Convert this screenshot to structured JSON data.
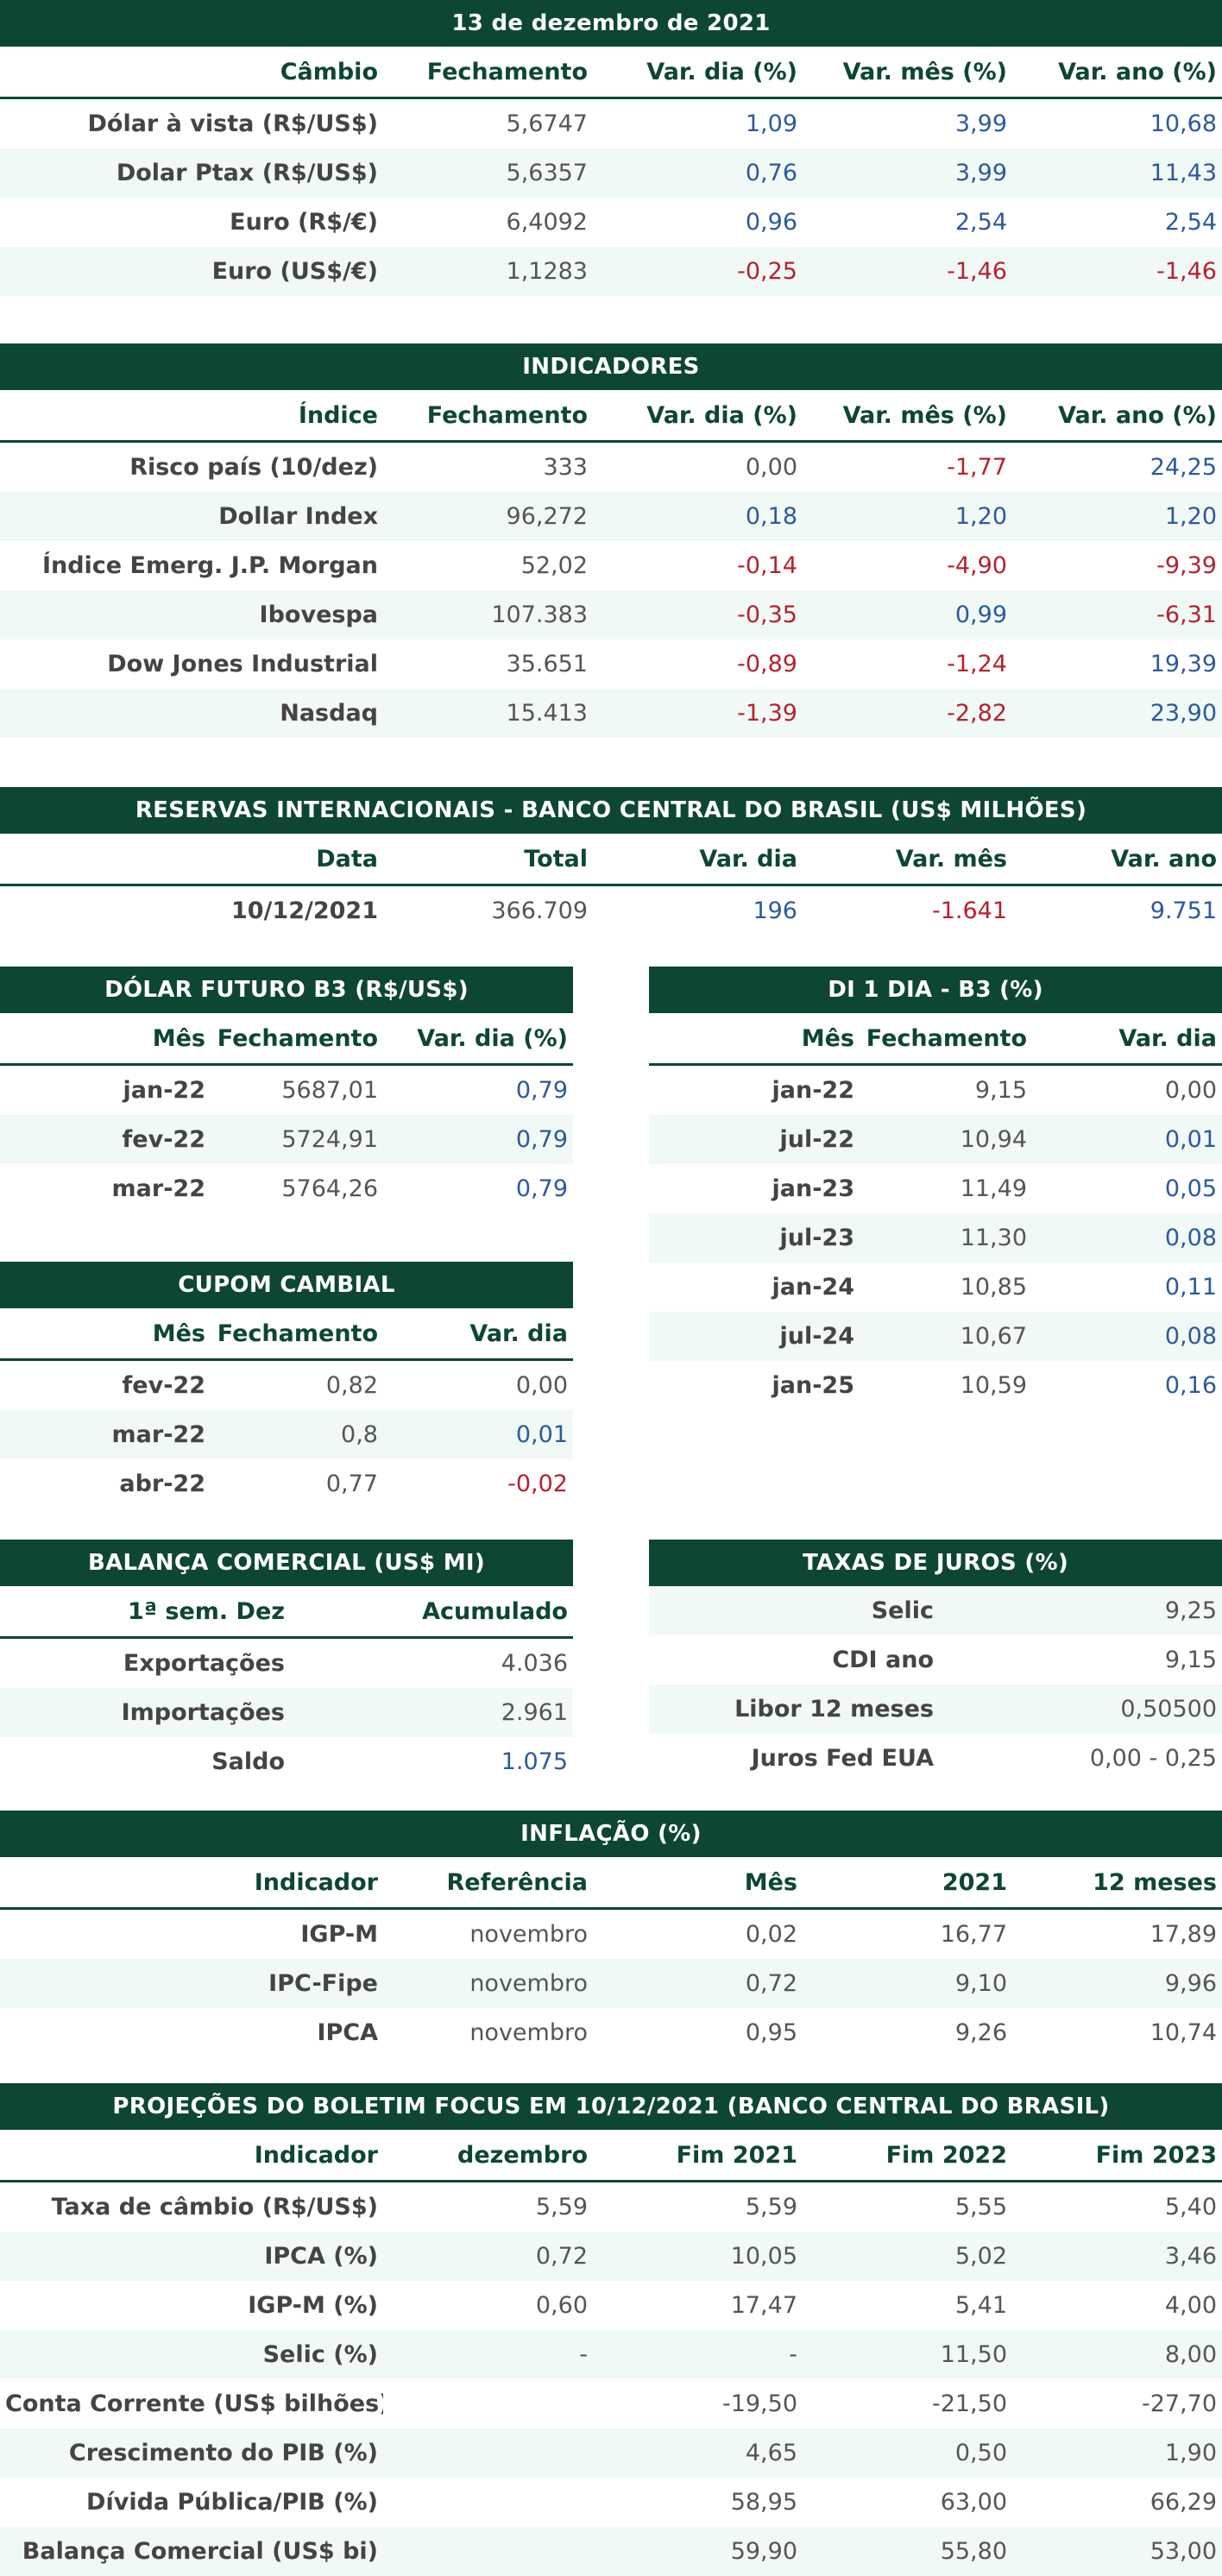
{
  "cambio": {
    "title": "13 de dezembro de 2021",
    "headers": [
      "Câmbio",
      "Fechamento",
      "Var. dia (%)",
      "Var. mês (%)",
      "Var. ano (%)"
    ],
    "rows": [
      {
        "label": "Dólar à vista (R$/US$)",
        "close": "5,6747",
        "day": "1,09",
        "month": "3,99",
        "year": "10,68"
      },
      {
        "label": "Dolar Ptax (R$/US$)",
        "close": "5,6357",
        "day": "0,76",
        "month": "3,99",
        "year": "11,43"
      },
      {
        "label": "Euro (R$/€)",
        "close": "6,4092",
        "day": "0,96",
        "month": "2,54",
        "year": "2,54"
      },
      {
        "label": "Euro (US$/€)",
        "close": "1,1283",
        "day": "-0,25",
        "month": "-1,46",
        "year": "-1,46"
      }
    ]
  },
  "indicadores": {
    "title": "INDICADORES",
    "headers": [
      "Índice",
      "Fechamento",
      "Var. dia (%)",
      "Var. mês (%)",
      "Var. ano (%)"
    ],
    "rows": [
      {
        "label": "Risco país (10/dez)",
        "close": "333",
        "day": "0,00",
        "month": "-1,77",
        "year": "24,25"
      },
      {
        "label": "Dollar Index",
        "close": "96,272",
        "day": "0,18",
        "month": "1,20",
        "year": "1,20"
      },
      {
        "label": "Índice Emerg. J.P. Morgan",
        "close": "52,02",
        "day": "-0,14",
        "month": "-4,90",
        "year": "-9,39"
      },
      {
        "label": "Ibovespa",
        "close": "107.383",
        "day": "-0,35",
        "month": "0,99",
        "year": "-6,31"
      },
      {
        "label": "Dow Jones Industrial",
        "close": "35.651",
        "day": "-0,89",
        "month": "-1,24",
        "year": "19,39"
      },
      {
        "label": "Nasdaq",
        "close": "15.413",
        "day": "-1,39",
        "month": "-2,82",
        "year": "23,90"
      }
    ]
  },
  "reservas": {
    "title": "RESERVAS INTERNACIONAIS - BANCO CENTRAL DO BRASIL (US$ MILHÕES)",
    "headers": [
      "Data",
      "Total",
      "Var. dia",
      "Var. mês",
      "Var. ano"
    ],
    "rows": [
      {
        "label": "10/12/2021",
        "close": "366.709",
        "day": "196",
        "month": "-1.641",
        "year": "9.751"
      }
    ]
  },
  "dolar_futuro": {
    "title": "DÓLAR FUTURO B3 (R$/US$)",
    "headers": [
      "Mês",
      "Fechamento",
      "Var. dia (%)"
    ],
    "rows": [
      {
        "label": "jan-22",
        "close": "5687,01",
        "day": "0,79"
      },
      {
        "label": "fev-22",
        "close": "5724,91",
        "day": "0,79"
      },
      {
        "label": "mar-22",
        "close": "5764,26",
        "day": "0,79"
      }
    ]
  },
  "di": {
    "title": "DI 1 DIA - B3 (%)",
    "headers": [
      "Mês",
      "Fechamento",
      "Var. dia"
    ],
    "rows": [
      {
        "label": "jan-22",
        "close": "9,15",
        "day": "0,00"
      },
      {
        "label": "jul-22",
        "close": "10,94",
        "day": "0,01"
      },
      {
        "label": "jan-23",
        "close": "11,49",
        "day": "0,05"
      },
      {
        "label": "jul-23",
        "close": "11,30",
        "day": "0,08"
      },
      {
        "label": "jan-24",
        "close": "10,85",
        "day": "0,11"
      },
      {
        "label": "jul-24",
        "close": "10,67",
        "day": "0,08"
      },
      {
        "label": "jan-25",
        "close": "10,59",
        "day": "0,16"
      }
    ]
  },
  "cupom": {
    "title": "CUPOM CAMBIAL",
    "headers": [
      "Mês",
      "Fechamento",
      "Var. dia"
    ],
    "rows": [
      {
        "label": "fev-22",
        "close": "0,82",
        "day": "0,00"
      },
      {
        "label": "mar-22",
        "close": "0,8",
        "day": "0,01"
      },
      {
        "label": "abr-22",
        "close": "0,77",
        "day": "-0,02"
      }
    ]
  },
  "balanca": {
    "title": "BALANÇA COMERCIAL (US$ MI)",
    "headers": [
      "1ª sem. Dez",
      "Acumulado"
    ],
    "rows": [
      {
        "label": "Exportações",
        "value": "4.036"
      },
      {
        "label": "Importações",
        "value": "2.961"
      },
      {
        "label": "Saldo",
        "value": "1.075"
      }
    ]
  },
  "juros": {
    "title": "TAXAS DE JUROS (%)",
    "rows": [
      {
        "label": "Selic",
        "value": "9,25"
      },
      {
        "label": "CDI ano",
        "value": "9,15"
      },
      {
        "label": "Libor 12 meses",
        "value": "0,50500"
      },
      {
        "label": "Juros Fed EUA",
        "value": "0,00 - 0,25"
      }
    ]
  },
  "inflacao": {
    "title": "INFLAÇÃO (%)",
    "headers": [
      "Indicador",
      "Referência",
      "Mês",
      "2021",
      "12 meses"
    ],
    "rows": [
      {
        "label": "IGP-M",
        "ref": "novembro",
        "month": "0,02",
        "year": "16,77",
        "m12": "17,89"
      },
      {
        "label": "IPC-Fipe",
        "ref": "novembro",
        "month": "0,72",
        "year": "9,10",
        "m12": "9,96"
      },
      {
        "label": "IPCA",
        "ref": "novembro",
        "month": "0,95",
        "year": "9,26",
        "m12": "10,74"
      }
    ]
  },
  "focus": {
    "title": "PROJEÇÕES DO BOLETIM FOCUS EM 10/12/2021 (BANCO CENTRAL DO BRASIL)",
    "headers": [
      "Indicador",
      "dezembro",
      "Fim 2021",
      "Fim 2022",
      "Fim 2023"
    ],
    "rows": [
      {
        "label": "Taxa de câmbio (R$/US$)",
        "c1": "5,59",
        "c2": "5,59",
        "c3": "5,55",
        "c4": "5,40"
      },
      {
        "label": "IPCA (%)",
        "c1": "0,72",
        "c2": "10,05",
        "c3": "5,02",
        "c4": "3,46"
      },
      {
        "label": "IGP-M (%)",
        "c1": "0,60",
        "c2": "17,47",
        "c3": "5,41",
        "c4": "4,00"
      },
      {
        "label": "Selic (%)",
        "c1": "-",
        "c2": "-",
        "c3": "11,50",
        "c4": "8,00"
      },
      {
        "label": "Conta Corrente (US$ bilhões)",
        "c1": "",
        "c2": "-19,50",
        "c3": "-21,50",
        "c4": "-27,70"
      },
      {
        "label": "Crescimento do PIB (%)",
        "c1": "",
        "c2": "4,65",
        "c3": "0,50",
        "c4": "1,90"
      },
      {
        "label": "Dívida Pública/PIB (%)",
        "c1": "",
        "c2": "58,95",
        "c3": "63,00",
        "c4": "66,29"
      },
      {
        "label": "Balança Comercial (US$ bi)",
        "c1": "",
        "c2": "59,90",
        "c3": "55,80",
        "c4": "53,00"
      }
    ]
  },
  "colors": {
    "header_bg": "#0e4634",
    "positive": "#2c5a9a",
    "negative": "#b5222e",
    "row_alt": "#f1f9f6"
  }
}
